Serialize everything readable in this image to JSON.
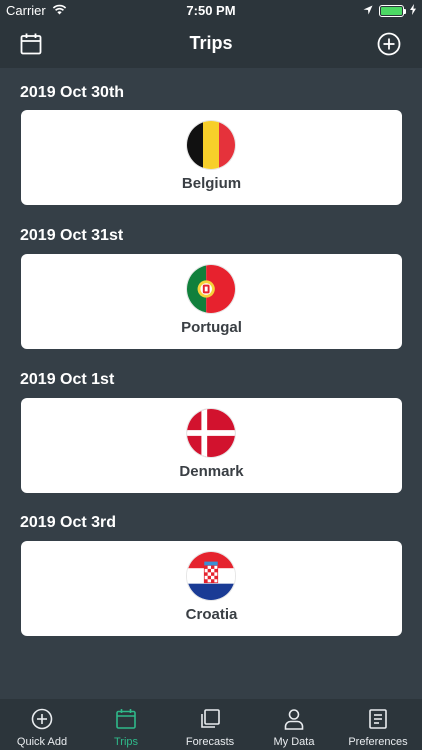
{
  "status_bar": {
    "carrier": "Carrier",
    "time": "7:50 PM",
    "battery_level": 1.0,
    "battery_color": "#4cd964"
  },
  "nav": {
    "title": "Trips",
    "left_icon": "calendar-icon",
    "right_icon": "add-circle-icon"
  },
  "trips": [
    {
      "date": "2019 Oct 30th",
      "country": "Belgium",
      "flag": "belgium-flag"
    },
    {
      "date": "2019 Oct 31st",
      "country": "Portugal",
      "flag": "portugal-flag"
    },
    {
      "date": "2019 Oct 1st",
      "country": "Denmark",
      "flag": "denmark-flag"
    },
    {
      "date": "2019 Oct 3rd",
      "country": "Croatia",
      "flag": "croatia-flag"
    }
  ],
  "tabs": [
    {
      "label": "Quick Add",
      "icon": "add-circle-icon",
      "active": false
    },
    {
      "label": "Trips",
      "icon": "calendar-icon",
      "active": true
    },
    {
      "label": "Forecasts",
      "icon": "copy-icon",
      "active": false
    },
    {
      "label": "My Data",
      "icon": "user-icon",
      "active": false
    },
    {
      "label": "Preferences",
      "icon": "document-icon",
      "active": false
    }
  ],
  "colors": {
    "background": "#353f47",
    "bar": "#2c353b",
    "accent": "#2fb98a"
  }
}
